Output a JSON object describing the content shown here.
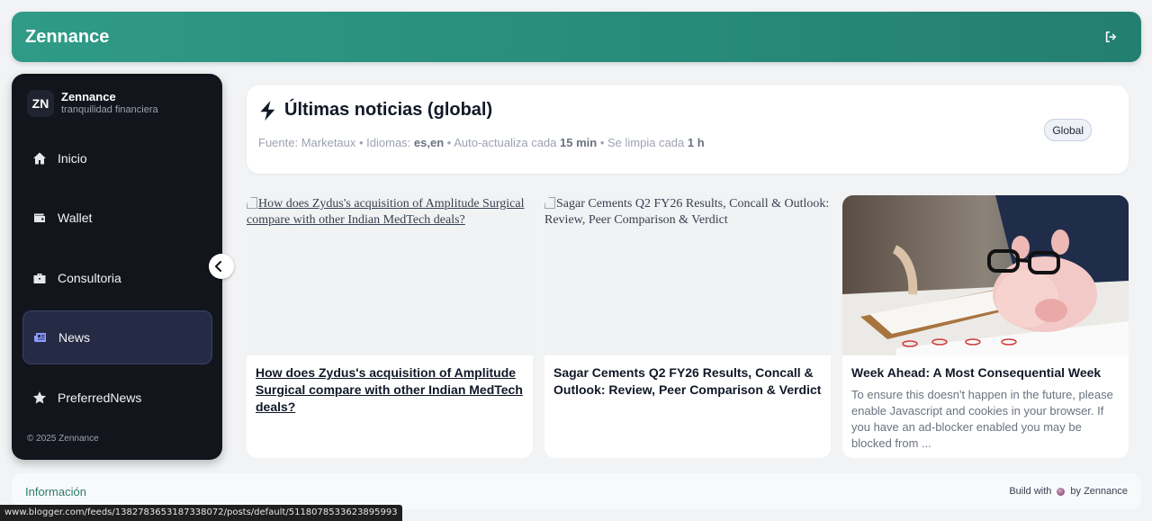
{
  "topbar": {
    "brand": "Zennance",
    "logout_icon": "logout-icon"
  },
  "sidebar": {
    "avatar": "ZN",
    "name": "Zennance",
    "tagline": "tranquilidad financiera",
    "items": [
      {
        "label": "Inicio",
        "icon": "home-icon",
        "active": false
      },
      {
        "label": "Wallet",
        "icon": "wallet-icon",
        "active": false
      },
      {
        "label": "Consultoria",
        "icon": "briefcase-icon",
        "active": false
      },
      {
        "label": "News",
        "icon": "newspaper-icon",
        "active": true
      },
      {
        "label": "PreferredNews",
        "icon": "star-icon",
        "active": false
      }
    ],
    "footer": "© 2025 Zennance"
  },
  "header": {
    "title": "Últimas noticias (global)",
    "meta_source": "Fuente: Marketaux • Idiomas: ",
    "meta_langs": "es,en",
    "meta_refresh": " • Auto-actualiza cada ",
    "meta_refresh_val": "15 min",
    "meta_clean": " • Se limpia cada ",
    "meta_clean_val": "1 h",
    "badge": "Global"
  },
  "cards": [
    {
      "image_alt": "How does Zydus's acquisition of Amplitude Surgical compare with other Indian MedTech deals?",
      "title": "How does Zydus's acquisition of Amplitude Surgical compare with other Indian MedTech deals?",
      "description": ""
    },
    {
      "image_alt": "Sagar Cements Q2 FY26 Results, Concall & Outlook: Review, Peer Comparison & Verdict",
      "title": "Sagar Cements Q2 FY26 Results, Concall & Outlook: Review, Peer Comparison & Verdict",
      "description": ""
    },
    {
      "image_alt": "",
      "title": "Week Ahead: A Most Consequential Week",
      "description": "To ensure this doesn't happen in the future, please enable Javascript and cookies in your browser. If you have an ad-blocker enabled you may be blocked from ..."
    }
  ],
  "footer": {
    "info": "Información",
    "build_prefix": "Build with",
    "build_suffix": "by Zennance"
  },
  "statusbar": "www.blogger.com/feeds/1382783653187338072/posts/default/5118078533623895993"
}
